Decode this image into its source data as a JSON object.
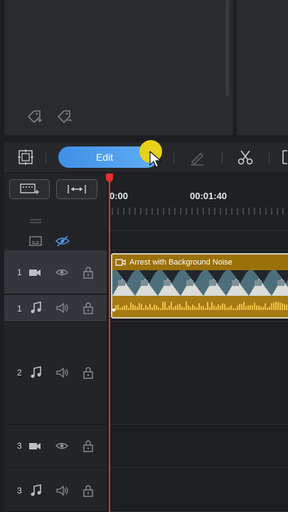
{
  "toolbar": {
    "edit_label": "Edit",
    "icons": [
      "crop-icon",
      "pen-icon",
      "scissors-icon"
    ]
  },
  "timeline": {
    "timecodes": [
      "0:00",
      "00:01:40"
    ],
    "header_buttons": [
      "add-track-icon",
      "fit-timeline-icon"
    ]
  },
  "tracks": [
    {
      "number": "1",
      "type": "video",
      "visibility_icon": "eye-icon",
      "lock_icon": "lock-icon"
    },
    {
      "number": "1",
      "type": "audio",
      "visibility_icon": "speaker-icon",
      "lock_icon": "lock-icon"
    },
    {
      "number": "2",
      "type": "audio",
      "visibility_icon": "speaker-icon",
      "lock_icon": "lock-icon"
    },
    {
      "number": "3",
      "type": "video",
      "visibility_icon": "eye-icon",
      "lock_icon": "lock-icon"
    },
    {
      "number": "3",
      "type": "audio",
      "visibility_icon": "speaker-icon",
      "lock_icon": "lock-icon"
    }
  ],
  "clip": {
    "title": "Arrest with Background Noise",
    "color": "#9a7009"
  },
  "colors": {
    "accent": "#4a9bee",
    "playhead": "#e0312d",
    "clip": "#9a7009"
  }
}
